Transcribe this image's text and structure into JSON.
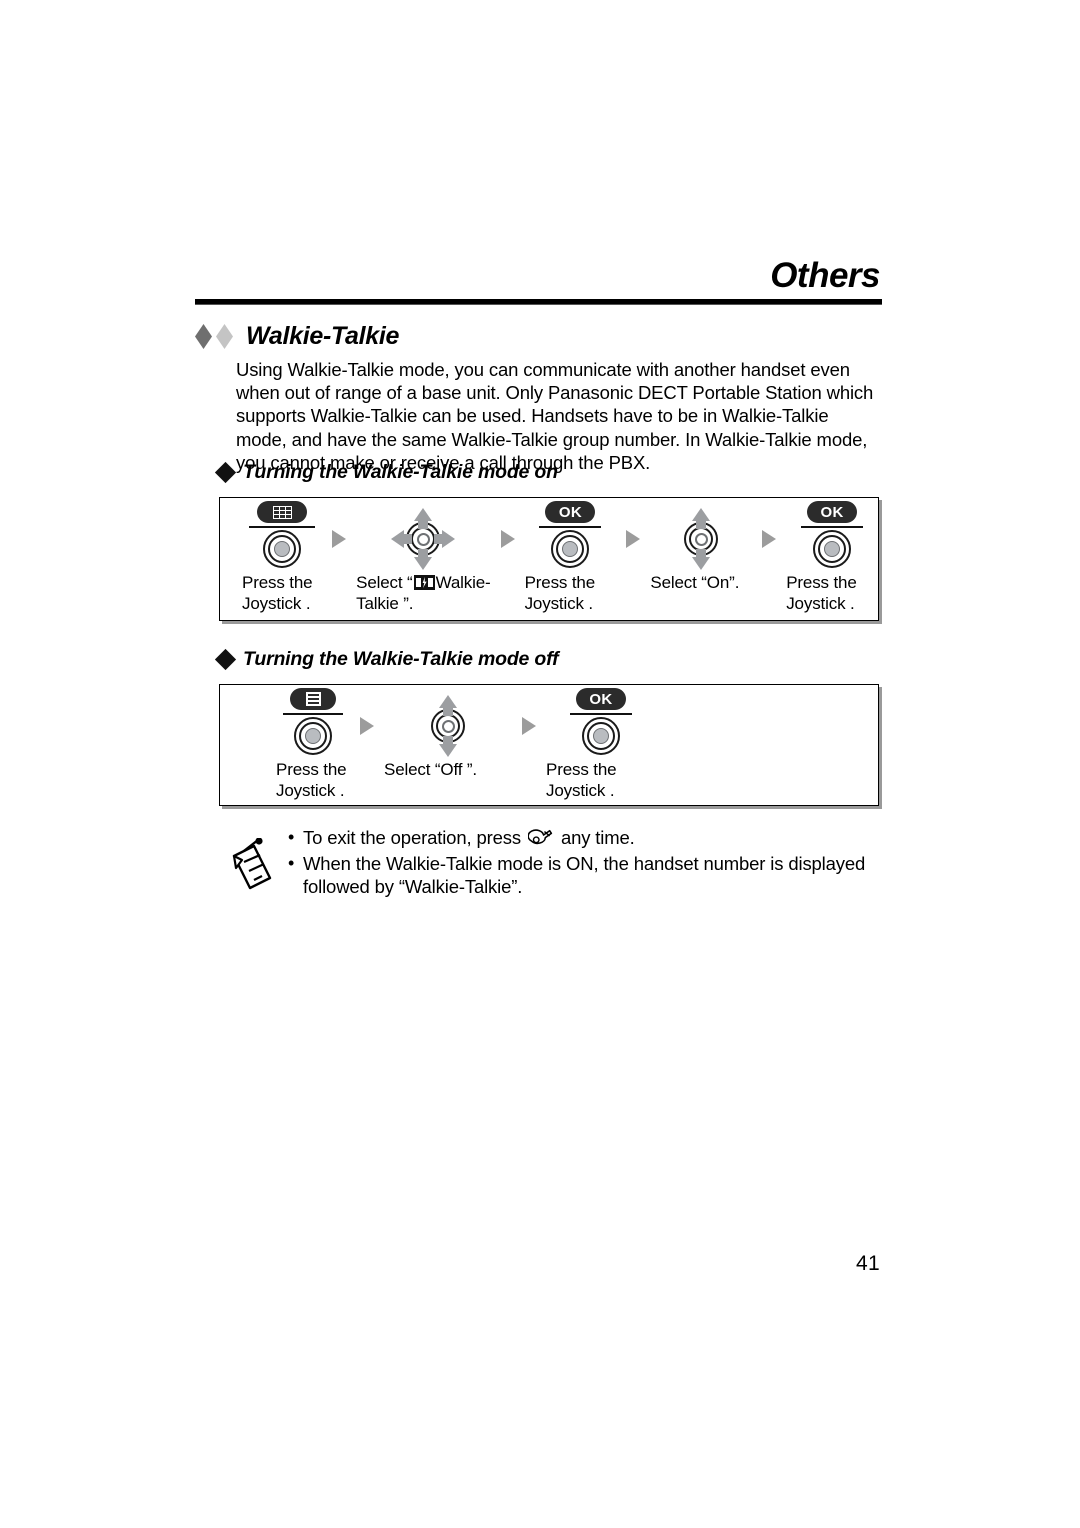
{
  "header": {
    "title": "Others"
  },
  "section": {
    "title": "Walkie-Talkie",
    "intro": "Using Walkie-Talkie mode, you can communicate with another handset even when out of range of a base unit. Only Panasonic DECT Portable Station which supports Walkie-Talkie can be used. Handsets have to be in Walkie-Talkie mode, and have the same Walkie-Talkie group number. In Walkie-Talkie mode, you cannot make or receive a call through the PBX."
  },
  "procedures": [
    {
      "heading": "Turning the Walkie-Talkie mode on",
      "steps": [
        {
          "icon": "menu-grid-key-icon",
          "caption_line1": "Press the",
          "caption_line2": "Joystick ."
        },
        {
          "icon": "joystick-four-way-icon",
          "caption_prefix": "Select “",
          "caption_glyph": "walkie-talkie-glyph",
          "caption_line1_suffix": "Walkie-",
          "caption_line2": "Talkie ”."
        },
        {
          "icon": "ok-key-icon",
          "caption_line1": "Press the",
          "caption_line2": "Joystick ."
        },
        {
          "icon": "joystick-up-down-icon",
          "caption_line1": "Select “On”.",
          "caption_line2": ""
        },
        {
          "icon": "ok-key-icon",
          "caption_line1": "Press the",
          "caption_line2": "Joystick ."
        }
      ]
    },
    {
      "heading": "Turning the Walkie-Talkie mode off",
      "steps": [
        {
          "icon": "menu-list-key-icon",
          "caption_line1": "Press the",
          "caption_line2": "Joystick ."
        },
        {
          "icon": "joystick-up-down-icon",
          "caption_line1": "Select “Off ”.",
          "caption_line2": ""
        },
        {
          "icon": "ok-key-icon",
          "caption_line1": "Press the",
          "caption_line2": "Joystick ."
        }
      ]
    }
  ],
  "ok_label": "OK",
  "notes": {
    "icon": "memo-note-icon",
    "bullet": "•",
    "items": [
      {
        "text_before": "To exit the operation, press",
        "glyph": "power-off-hook-key-glyph",
        "text_after": "any time."
      },
      {
        "text_before": "When the Walkie-Talkie mode is ON, the handset number is displayed followed by “Walkie-Talkie”.",
        "glyph": "",
        "text_after": ""
      }
    ]
  },
  "footer": {
    "page_number": "41"
  },
  "colors": {
    "text": "#000000",
    "key_dark": "#2b2b2b",
    "arrow_gray": "#9c9ea1",
    "joy_core": "#b9bcc0",
    "diamond_dark": "#6f6f6f",
    "diamond_light": "#c4c4c4"
  }
}
